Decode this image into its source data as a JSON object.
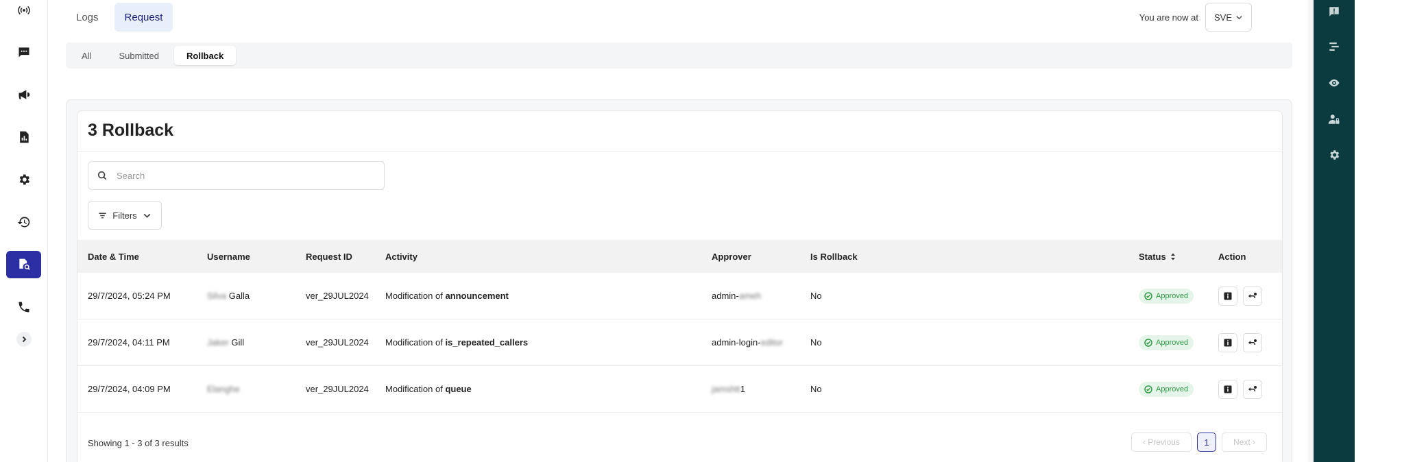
{
  "nav": {
    "top_tabs": [
      {
        "label": "Logs"
      },
      {
        "label": "Request"
      }
    ],
    "location_label": "You are now at",
    "location_value": "SVE"
  },
  "sub_tabs": [
    {
      "label": "All"
    },
    {
      "label": "Submitted"
    },
    {
      "label": "Rollback"
    }
  ],
  "card": {
    "title": "3 Rollback",
    "search_placeholder": "Search",
    "filters_label": "Filters"
  },
  "table": {
    "headers": {
      "date": "Date & Time",
      "username": "Username",
      "request_id": "Request ID",
      "activity": "Activity",
      "approver": "Approver",
      "is_rollback": "Is Rollback",
      "status": "Status",
      "action": "Action"
    },
    "rows": [
      {
        "date": "29/7/2024, 05:24 PM",
        "user_blur": "Silva",
        "user_visible": " Galla",
        "request_id": "ver_29JUL2024",
        "activity_prefix": "Modification of ",
        "activity_target": "announcement",
        "approver_visible": "admin-",
        "approver_blur": "ameh",
        "is_rollback": "No",
        "status": "Approved"
      },
      {
        "date": "29/7/2024, 04:11 PM",
        "user_blur": "Jaker",
        "user_visible": " Gill",
        "request_id": "ver_29JUL2024",
        "activity_prefix": "Modification of ",
        "activity_target": "is_repeated_callers",
        "approver_visible": "admin-login-",
        "approver_blur": "editor",
        "is_rollback": "No",
        "status": "Approved"
      },
      {
        "date": "29/7/2024, 04:09 PM",
        "user_blur": "Elanghe",
        "user_visible": "",
        "request_id": "ver_29JUL2024",
        "activity_prefix": "Modification of ",
        "activity_target": "queue",
        "approver_visible": "1",
        "approver_blur": "jamshtt",
        "is_rollback": "No",
        "status": "Approved"
      }
    ]
  },
  "footer": {
    "showing": "Showing 1 - 3 of 3 results",
    "prev": "‹ Previous",
    "page": "1",
    "next": "Next ›"
  }
}
